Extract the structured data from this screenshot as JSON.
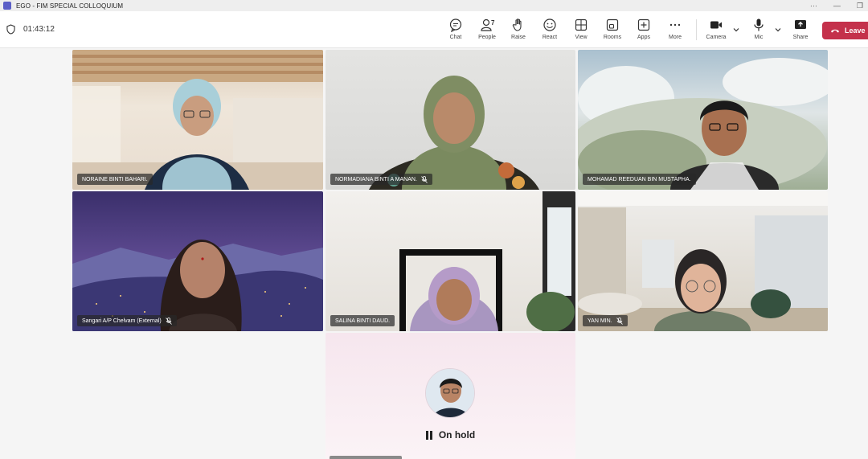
{
  "window": {
    "title": "EGO - FIM SPECIAL COLLOQUIUM",
    "controls": [
      "···",
      "—",
      "❐"
    ]
  },
  "meeting": {
    "timer": "01:43:12"
  },
  "toolbar": {
    "chat": "Chat",
    "people": "People",
    "people_count": "7",
    "raise": "Raise",
    "react": "React",
    "view": "View",
    "rooms": "Rooms",
    "apps": "Apps",
    "more": "More",
    "camera": "Camera",
    "mic": "Mic",
    "share": "Share",
    "leave": "Leave"
  },
  "participants": [
    {
      "name": "NORAINE BINTI BAHARI.",
      "muted": false
    },
    {
      "name": "NORMADIANA BINTI A MANAN.",
      "muted": true
    },
    {
      "name": "MOHAMAD REEDUAN BIN MUSTAPHA.",
      "muted": false
    },
    {
      "name": "Sangari A/P Chelvam (External)",
      "muted": true
    },
    {
      "name": "SALINA BINTI DAUD.",
      "muted": false
    },
    {
      "name": "YAN MIN.",
      "muted": true
    }
  ],
  "on_hold": {
    "text": "On hold"
  },
  "colors": {
    "accent": "#5b5fc7",
    "leave": "#c4314b"
  }
}
